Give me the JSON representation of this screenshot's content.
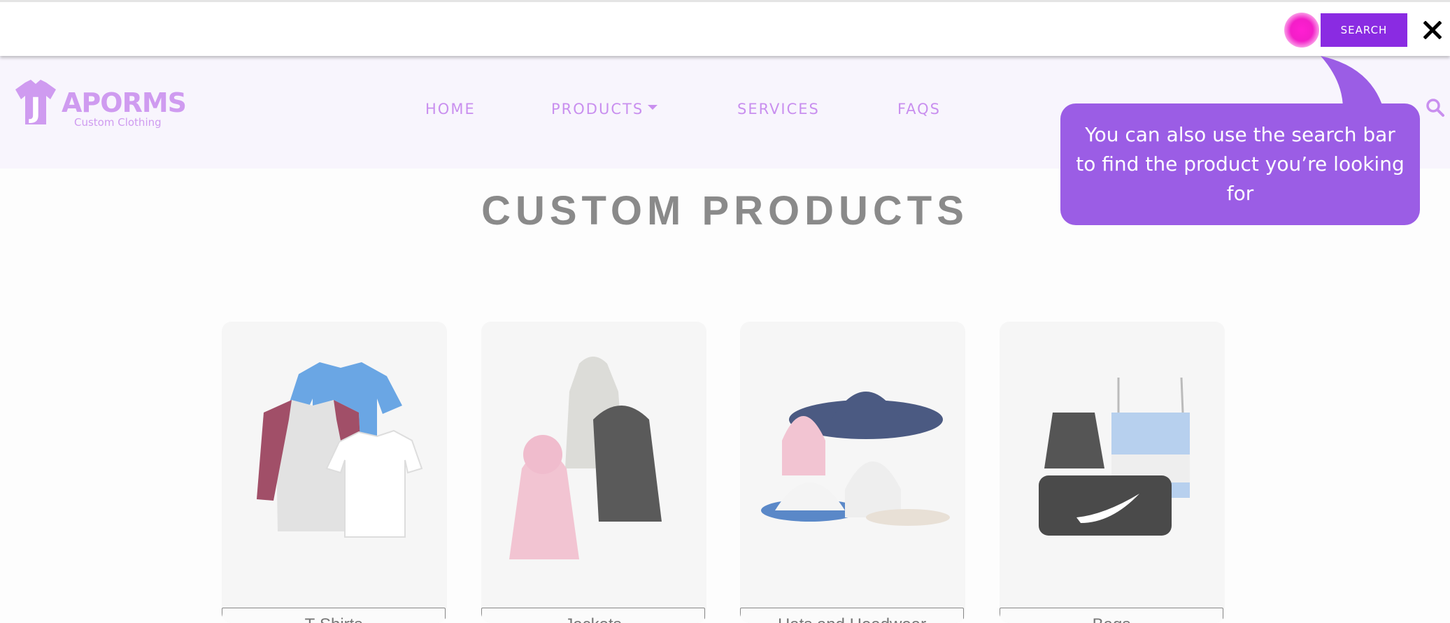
{
  "search": {
    "button_label": "SEARCH",
    "placeholder": ""
  },
  "brand": {
    "name": "APORMS",
    "tagline": "Custom Clothing",
    "mark_letter": "J"
  },
  "nav": [
    {
      "label": "HOME"
    },
    {
      "label": "PRODUCTS",
      "has_dropdown": true
    },
    {
      "label": "SERVICES"
    },
    {
      "label": "FAQS"
    }
  ],
  "page": {
    "title": "CUSTOM PRODUCTS"
  },
  "tooltip": {
    "text": "You can also use the search bar to find the product you’re looking for"
  },
  "products": [
    {
      "label": "T-Shirts",
      "icon": "tshirts-image"
    },
    {
      "label": "Jackets",
      "icon": "jackets-image"
    },
    {
      "label": "Hats and Headwear",
      "icon": "hats-image"
    },
    {
      "label": "Bags",
      "icon": "bags-image"
    }
  ],
  "colors": {
    "accent": "#8a2be2",
    "tooltip": "#9b5de5",
    "hotspot": "#f31ec8",
    "nav": "#c98fef"
  }
}
